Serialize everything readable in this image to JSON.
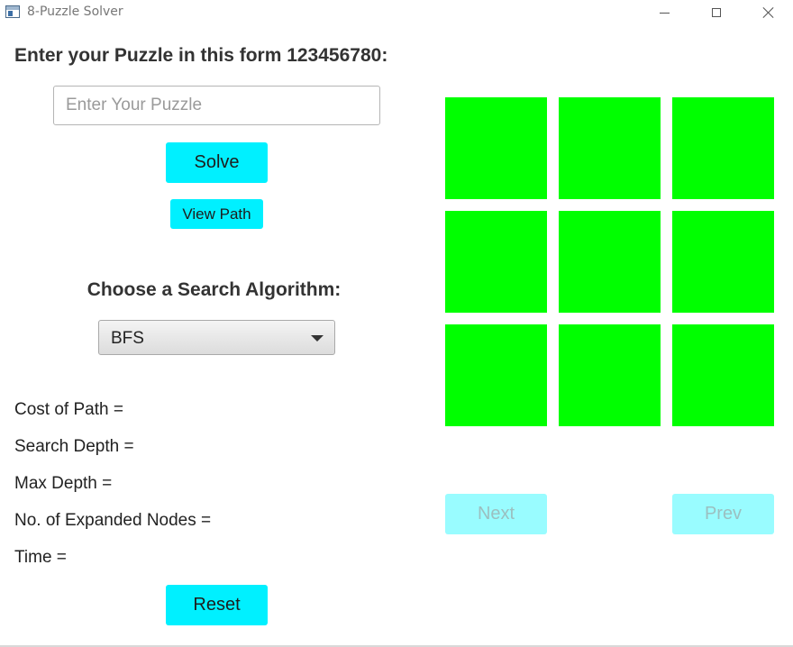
{
  "window": {
    "title": "8-Puzzle Solver",
    "icon": "app-window-icon"
  },
  "form": {
    "heading": "Enter your Puzzle in this form 123456780:",
    "input_value": "",
    "input_placeholder": "Enter Your Puzzle",
    "solve_label": "Solve",
    "view_path_label": "View Path"
  },
  "algorithm": {
    "heading": "Choose a Search Algorithm:",
    "selected": "BFS"
  },
  "stats": {
    "cost_label": "Cost of Path =",
    "search_depth_label": "Search Depth =",
    "max_depth_label": "Max Depth =",
    "expanded_label": "No. of Expanded Nodes =",
    "time_label": "Time ="
  },
  "reset_label": "Reset",
  "board": {
    "tiles": [
      "",
      "",
      "",
      "",
      "",
      "",
      "",
      "",
      ""
    ],
    "tile_color": "#00ff00"
  },
  "navigation": {
    "next_label": "Next",
    "prev_label": "Prev",
    "next_enabled": false,
    "prev_enabled": false
  },
  "colors": {
    "accent_button": "#00f0ff",
    "disabled_button": "#99fcff",
    "disabled_text": "#9bbfc0"
  }
}
